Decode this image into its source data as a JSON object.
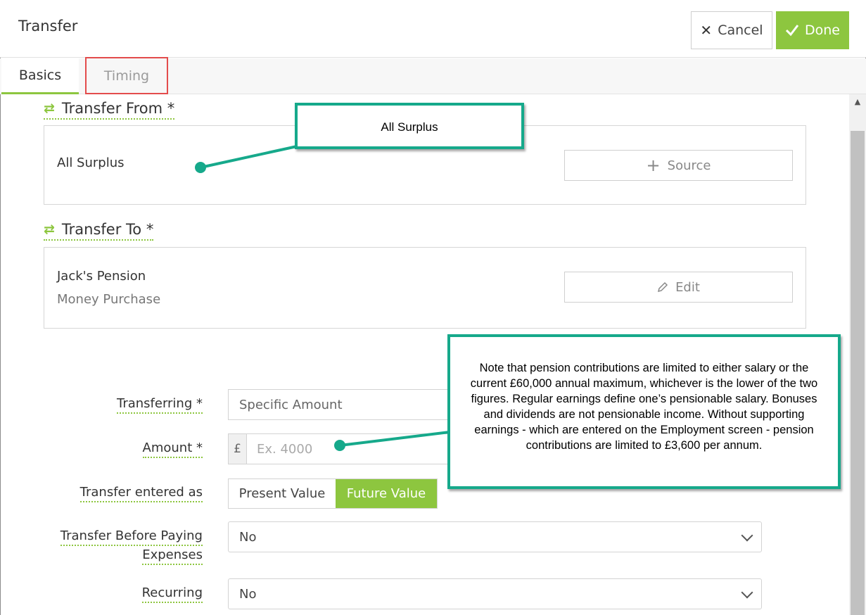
{
  "window": {
    "title": "Transfer",
    "cancel_label": "Cancel",
    "done_label": "Done",
    "accent_color": "#8dc63f",
    "callout_color": "#16a98b",
    "highlight_color": "#e34c4c"
  },
  "tabs": [
    {
      "label": "Basics",
      "active": true
    },
    {
      "label": "Timing",
      "active": false
    }
  ],
  "transfer_from": {
    "heading": "Transfer From *",
    "value": "All Surplus",
    "button_label": "Source",
    "button_icon": "plus-icon"
  },
  "transfer_to": {
    "heading": "Transfer To *",
    "name": "Jack's Pension",
    "type": "Money Purchase",
    "button_label": "Edit",
    "button_icon": "pencil-icon"
  },
  "form": {
    "transferring": {
      "label": "Transferring *",
      "value": "Specific Amount"
    },
    "amount": {
      "label": "Amount *",
      "currency": "£",
      "placeholder": "Ex. 4000"
    },
    "entered_as": {
      "label": "Transfer entered as",
      "options": [
        "Present Value",
        "Future Value"
      ],
      "selected": "Future Value"
    },
    "before_expenses": {
      "label_line1": "Transfer Before Paying",
      "label_line2": "Expenses",
      "value": "No"
    },
    "recurring": {
      "label": "Recurring",
      "value": "No"
    }
  },
  "callouts": {
    "surplus": "All Surplus",
    "pension_note": "Note that pension contributions are limited to either salary or the current £60,000 annual maximum, whichever is the lower of the two figures. Regular earnings define one’s pensionable salary. Bonuses and dividends are not pensionable income. Without supporting earnings - which are entered on the Employment screen - pension contributions are limited to £3,600 per annum."
  }
}
